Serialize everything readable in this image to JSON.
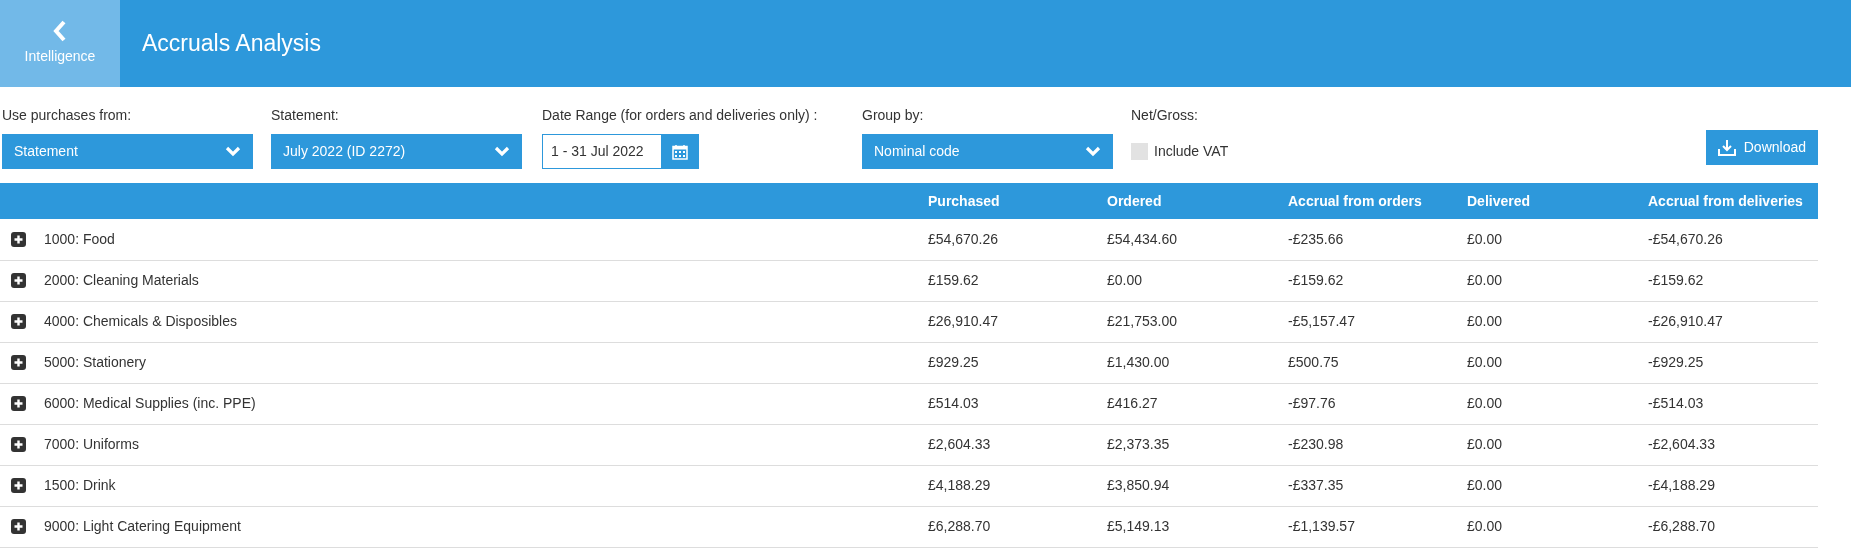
{
  "header": {
    "back_label": "Intelligence",
    "title": "Accruals Analysis"
  },
  "filters": [
    {
      "kind": "select",
      "label": "Use purchases from:",
      "value": "Statement"
    },
    {
      "kind": "select",
      "label": "Statement:",
      "value": "July 2022 (ID 2272)"
    },
    {
      "kind": "date",
      "label": "Date Range (for orders and deliveries only) :",
      "value": "1 - 31 Jul 2022"
    },
    {
      "kind": "select",
      "label": "Group by:",
      "value": "Nominal code"
    },
    {
      "kind": "checkbox",
      "label": "Net/Gross:",
      "value": "Include VAT",
      "checked": false
    }
  ],
  "download_button": "Download",
  "table": {
    "columns": [
      "Purchased",
      "Ordered",
      "Accrual from orders",
      "Delivered",
      "Accrual from deliveries"
    ],
    "rows": [
      {
        "name": "1000: Food",
        "cells": [
          "£54,670.26",
          "£54,434.60",
          "-£235.66",
          "£0.00",
          "-£54,670.26"
        ]
      },
      {
        "name": "2000: Cleaning Materials",
        "cells": [
          "£159.62",
          "£0.00",
          "-£159.62",
          "£0.00",
          "-£159.62"
        ]
      },
      {
        "name": "4000: Chemicals & Disposibles",
        "cells": [
          "£26,910.47",
          "£21,753.00",
          "-£5,157.47",
          "£0.00",
          "-£26,910.47"
        ]
      },
      {
        "name": "5000: Stationery",
        "cells": [
          "£929.25",
          "£1,430.00",
          "£500.75",
          "£0.00",
          "-£929.25"
        ]
      },
      {
        "name": "6000: Medical Supplies (inc. PPE)",
        "cells": [
          "£514.03",
          "£416.27",
          "-£97.76",
          "£0.00",
          "-£514.03"
        ]
      },
      {
        "name": "7000: Uniforms",
        "cells": [
          "£2,604.33",
          "£2,373.35",
          "-£230.98",
          "£0.00",
          "-£2,604.33"
        ]
      },
      {
        "name": "1500: Drink",
        "cells": [
          "£4,188.29",
          "£3,850.94",
          "-£337.35",
          "£0.00",
          "-£4,188.29"
        ]
      },
      {
        "name": "9000: Light Catering Equipment",
        "cells": [
          "£6,288.70",
          "£5,149.13",
          "-£1,139.57",
          "£0.00",
          "-£6,288.70"
        ]
      }
    ]
  }
}
